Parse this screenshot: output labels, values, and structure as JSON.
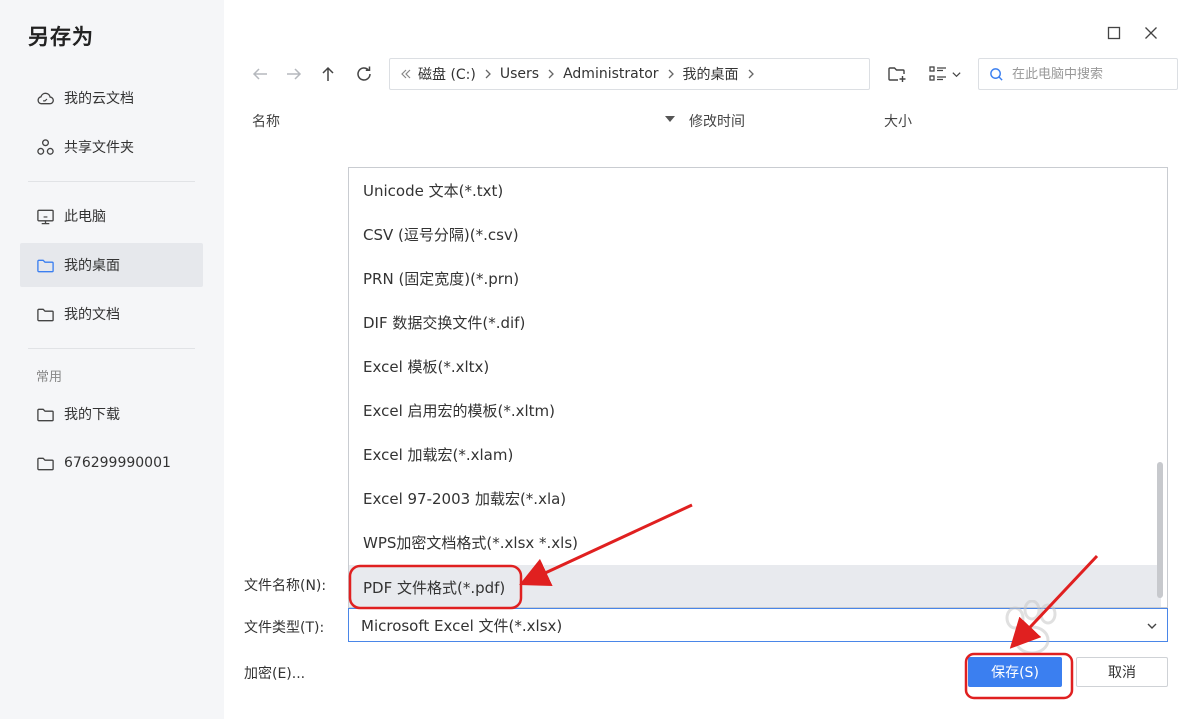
{
  "dialog": {
    "title": "另存为"
  },
  "sidebar": {
    "items": [
      {
        "label": "我的云文档",
        "icon": "cloud-icon"
      },
      {
        "label": "共享文件夹",
        "icon": "share-icon"
      },
      {
        "label": "此电脑",
        "icon": "monitor-icon"
      },
      {
        "label": "我的桌面",
        "icon": "folder-icon",
        "active": true
      },
      {
        "label": "我的文档",
        "icon": "folder-icon"
      }
    ],
    "section_label": "常用",
    "common": [
      {
        "label": "我的下载",
        "icon": "folder-icon"
      },
      {
        "label": "676299990001",
        "icon": "folder-icon"
      }
    ]
  },
  "toolbar": {
    "breadcrumb": [
      "磁盘 (C:)",
      "Users",
      "Administrator",
      "我的桌面"
    ],
    "search_placeholder": "在此电脑中搜索"
  },
  "columns": {
    "name": "名称",
    "modified": "修改时间",
    "size": "大小"
  },
  "file_types": [
    "Unicode 文本(*.txt)",
    "CSV (逗号分隔)(*.csv)",
    "PRN (固定宽度)(*.prn)",
    "DIF 数据交换文件(*.dif)",
    "Excel 模板(*.xltx)",
    "Excel 启用宏的模板(*.xltm)",
    "Excel 加载宏(*.xlam)",
    "Excel 97-2003 加载宏(*.xla)",
    "WPS加密文档格式(*.xlsx *.xls)",
    "PDF 文件格式(*.pdf)"
  ],
  "form": {
    "filename_label": "文件名称(N):",
    "filetype_label": "文件类型(T):",
    "filetype_value": "Microsoft Excel 文件(*.xlsx)",
    "encrypt_label": "加密(E)...",
    "save_label": "保存(S)",
    "cancel_label": "取消"
  },
  "colors": {
    "accent": "#3b7ff0",
    "annotation": "#e02020",
    "sidebar_bg": "#f5f6f8"
  }
}
